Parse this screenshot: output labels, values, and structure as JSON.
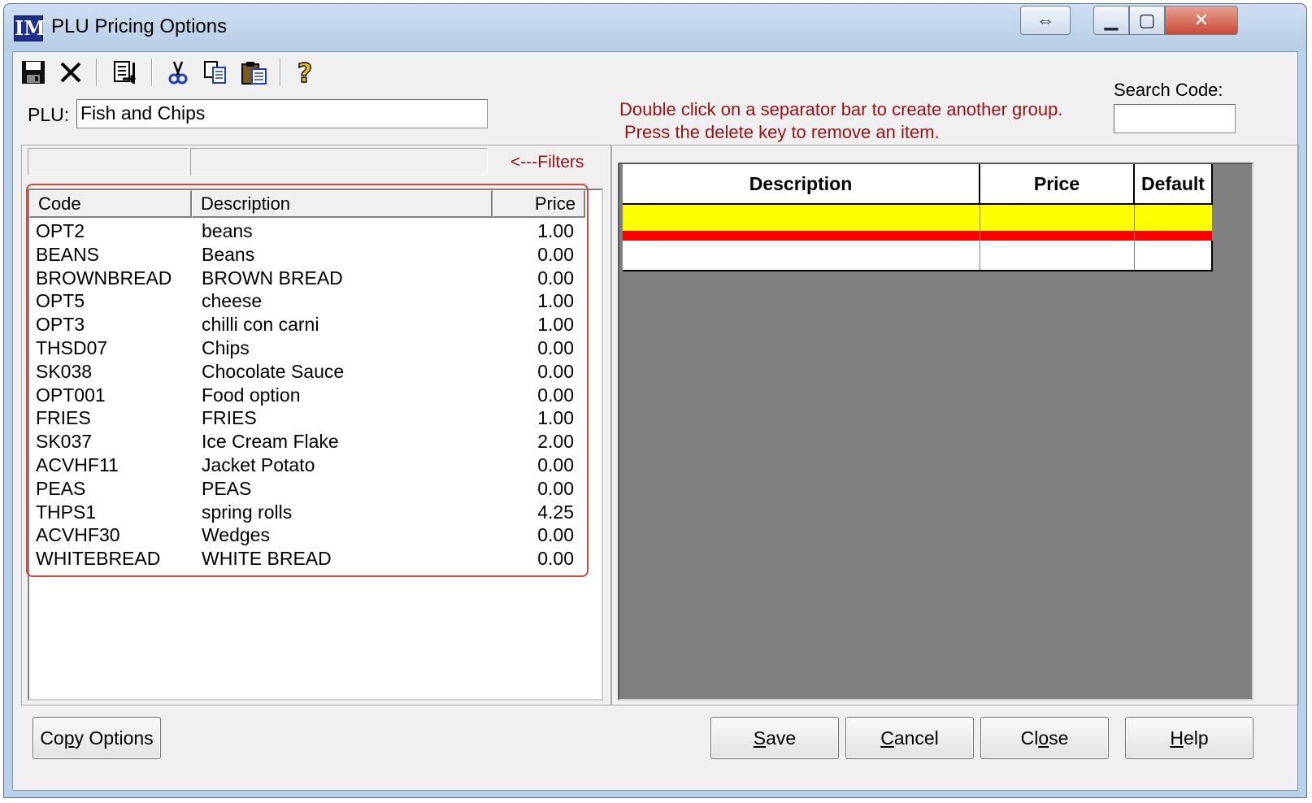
{
  "window": {
    "logo": "IM",
    "title": "PLU Pricing Options",
    "controls": {
      "resize": "⇔",
      "minimize": "▁",
      "maximize": "▢",
      "close": "✕"
    }
  },
  "toolbar": {
    "icons": [
      "save-icon",
      "delete-icon",
      "export-icon",
      "cut-icon",
      "copy-icon",
      "paste-icon",
      "help-icon"
    ]
  },
  "plu": {
    "label": "PLU:",
    "value": "Fish and Chips"
  },
  "hint": {
    "line1": "Double click on a separator bar to create another group.",
    "line2": "Press the delete key to remove an item."
  },
  "search": {
    "label": "Search Code:",
    "value": ""
  },
  "filters": {
    "code": "",
    "description": "",
    "label": "<---Filters"
  },
  "list": {
    "columns": {
      "code": "Code",
      "description": "Description",
      "price": "Price"
    },
    "rows": [
      {
        "code": "OPT2",
        "description": "beans",
        "price": "1.00"
      },
      {
        "code": "BEANS",
        "description": "Beans",
        "price": "0.00"
      },
      {
        "code": "BROWNBREAD",
        "description": "BROWN BREAD",
        "price": "0.00"
      },
      {
        "code": "OPT5",
        "description": "cheese",
        "price": "1.00"
      },
      {
        "code": "OPT3",
        "description": "chilli con carni",
        "price": "1.00"
      },
      {
        "code": "THSD07",
        "description": "Chips",
        "price": "0.00"
      },
      {
        "code": "SK038",
        "description": "Chocolate Sauce",
        "price": "0.00"
      },
      {
        "code": "OPT001",
        "description": "Food option",
        "price": "0.00"
      },
      {
        "code": "FRIES",
        "description": "FRIES",
        "price": "1.00"
      },
      {
        "code": "SK037",
        "description": "Ice Cream Flake",
        "price": "2.00"
      },
      {
        "code": "ACVHF11",
        "description": "Jacket Potato",
        "price": "0.00"
      },
      {
        "code": "PEAS",
        "description": "PEAS",
        "price": "0.00"
      },
      {
        "code": "THPS1",
        "description": "spring rolls",
        "price": "4.25"
      },
      {
        "code": "ACVHF30",
        "description": "Wedges",
        "price": "0.00"
      },
      {
        "code": "WHITEBREAD",
        "description": "WHITE BREAD",
        "price": "0.00"
      }
    ]
  },
  "grid": {
    "columns": {
      "description": "Description",
      "price": "Price",
      "default": "Default"
    },
    "colors": {
      "selected_row": "#ffff00",
      "separator": "#ff0000",
      "background": "#808080"
    }
  },
  "buttons": {
    "copy_options": {
      "pre": "Co",
      "key": "p",
      "post": "y Options"
    },
    "save": {
      "key": "S",
      "post": "ave"
    },
    "cancel": {
      "key": "C",
      "post": "ancel"
    },
    "close": {
      "pre": "Cl",
      "key": "o",
      "post": "se"
    },
    "help": {
      "key": "H",
      "post": "elp"
    }
  }
}
